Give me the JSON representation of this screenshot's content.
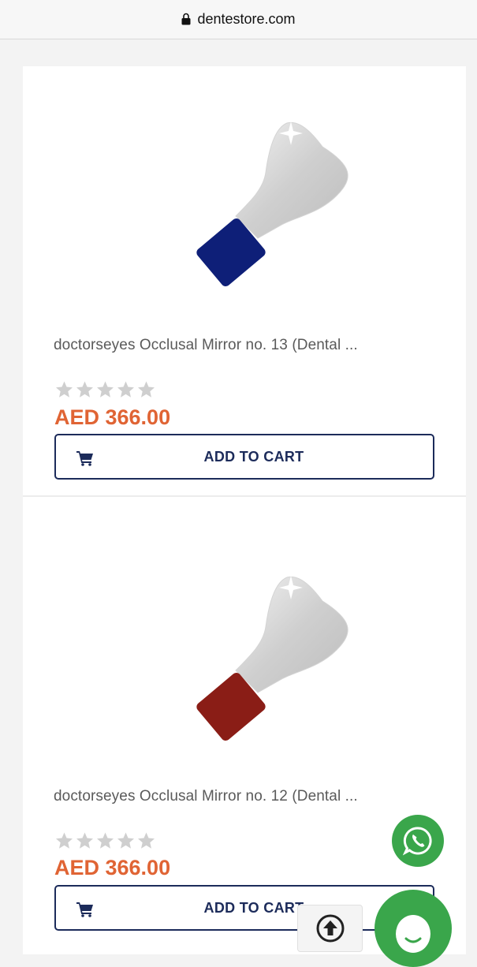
{
  "browser": {
    "url": "dentestore.com"
  },
  "products": [
    {
      "title": "doctorseyes Occlusal Mirror no. 13 (Dental ...",
      "price": "AED 366.00",
      "rating": 0,
      "rating_max": 5,
      "cart_label": "ADD TO CART",
      "handle_color": "#0e1f78"
    },
    {
      "title": "doctorseyes Occlusal Mirror no. 12 (Dental ...",
      "price": "AED 366.00",
      "rating": 0,
      "rating_max": 5,
      "cart_label": "ADD TO CART",
      "handle_color": "#8a1d16"
    }
  ],
  "floating": {
    "whatsapp_icon": "whatsapp-icon",
    "scroll_top_icon": "arrow-up-circle-icon",
    "chat_icon": "chat-bubble-icon"
  },
  "colors": {
    "price": "#e06434",
    "button_border": "#1c2b5a",
    "whatsapp_green": "#3aa64b"
  }
}
